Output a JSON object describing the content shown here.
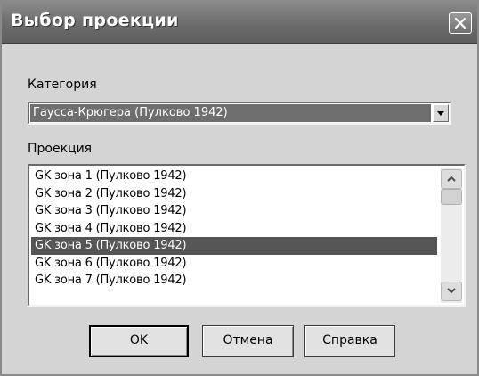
{
  "window": {
    "title": "Выбор проекции"
  },
  "category": {
    "label": "Категория",
    "selected": "Гаусса-Крюгера (Пулково 1942)"
  },
  "projection": {
    "label": "Проекция",
    "items": [
      "GK зона 1  (Пулково 1942)",
      "GK зона 2  (Пулково 1942)",
      "GK зона 3  (Пулково 1942)",
      "GK зона 4  (Пулково 1942)",
      "GK зона 5  (Пулково 1942)",
      "GK зона 6  (Пулково 1942)",
      "GK зона 7  (Пулково 1942)"
    ],
    "selected_index": 4
  },
  "buttons": {
    "ok": "OK",
    "cancel": "Отмена",
    "help": "Справка"
  }
}
